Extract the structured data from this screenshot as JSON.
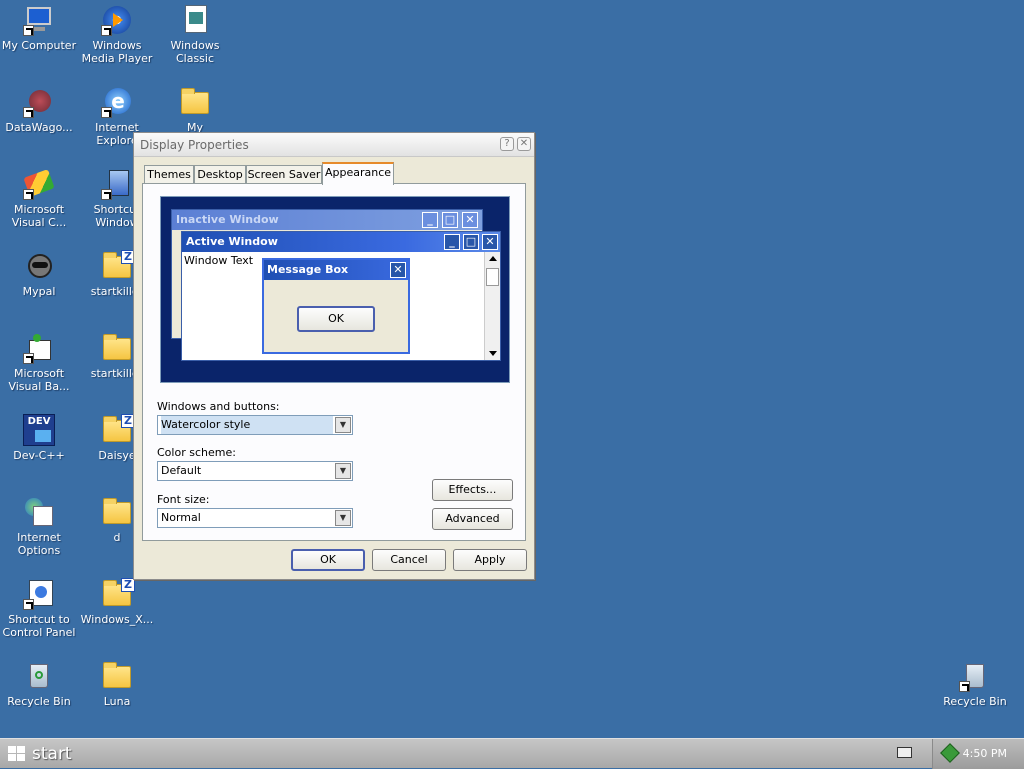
{
  "desktop": {
    "icons": [
      {
        "label": "My Computer"
      },
      {
        "label": "Windows Media Player"
      },
      {
        "label": "Windows Classic"
      },
      {
        "label": "DataWago..."
      },
      {
        "label": "Internet Explore"
      },
      {
        "label": "My"
      },
      {
        "label": "Microsoft Visual C..."
      },
      {
        "label": "Shortcut Window"
      },
      {
        "label": "Mypal"
      },
      {
        "label": "startkiller"
      },
      {
        "label": "Microsoft Visual Ba..."
      },
      {
        "label": "startkiller"
      },
      {
        "label": "Dev-C++"
      },
      {
        "label": "Daisye"
      },
      {
        "label": "Internet Options"
      },
      {
        "label": "d"
      },
      {
        "label": "Shortcut to Control Panel"
      },
      {
        "label": "Windows_X..."
      },
      {
        "label": "Recycle Bin"
      },
      {
        "label": "Luna"
      },
      {
        "label": "Recycle Bin"
      }
    ]
  },
  "dialog": {
    "title": "Display Properties",
    "help_glyph": "?",
    "close_glyph": "✕",
    "tabs": [
      "Themes",
      "Desktop",
      "Screen Saver",
      "Appearance"
    ],
    "active_tab": "Appearance",
    "preview": {
      "inactive_title": "Inactive Window",
      "active_title": "Active Window",
      "window_text": "Window Text",
      "message_box_title": "Message Box",
      "ok_label": "OK",
      "min_glyph": "_",
      "max_glyph": "□",
      "close_glyph": "✕"
    },
    "windows_buttons_label": "Windows and buttons:",
    "windows_buttons_value": "Watercolor style",
    "color_scheme_label": "Color scheme:",
    "color_scheme_value": "Default",
    "font_size_label": "Font size:",
    "font_size_value": "Normal",
    "effects_label": "Effects...",
    "advanced_label": "Advanced",
    "ok_label": "OK",
    "cancel_label": "Cancel",
    "apply_label": "Apply"
  },
  "taskbar": {
    "start_label": "start",
    "clock": "4:50 PM"
  },
  "colors": {
    "desktop": "#3a6ea5",
    "dialog_face": "#ece9d8",
    "preview_active_title": "#3062c8",
    "preview_inactive_title": "#5b7fd4",
    "tab_highlight": "#e68b2c"
  }
}
